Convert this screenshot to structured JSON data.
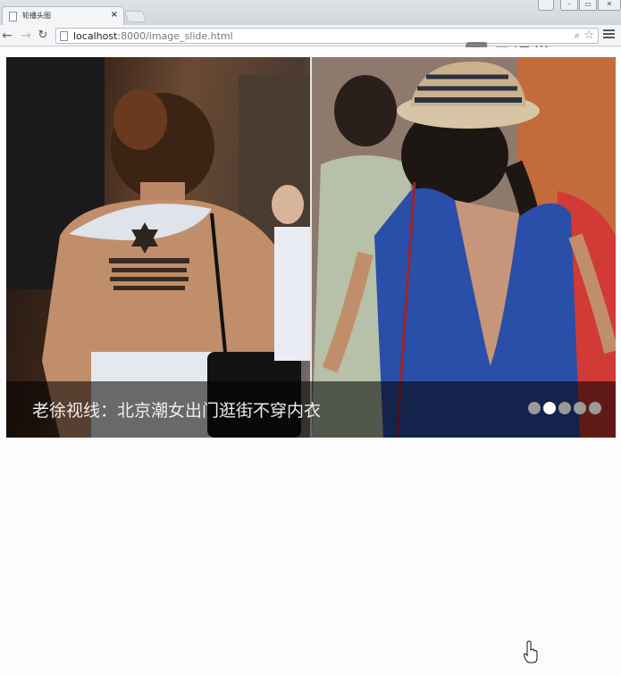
{
  "browser": {
    "tab_title": "轮播头图",
    "tab_close": "×",
    "url_host": "localhost",
    "url_path": ":8000/image_slide.html"
  },
  "watermark": {
    "text": "云课堂"
  },
  "slider": {
    "caption": "老徐视线：北京潮女出门逛街不穿内衣",
    "slide_count": 5,
    "active_index": 1
  }
}
